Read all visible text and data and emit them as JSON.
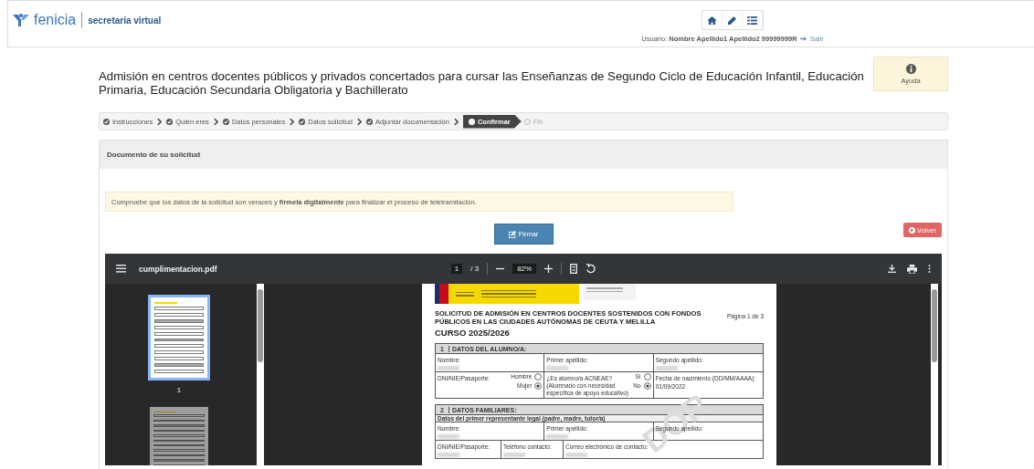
{
  "header": {
    "logo_text": "fenicia",
    "app_name": "secretaría virtual",
    "nav_buttons": [
      {
        "kind": "home"
      },
      {
        "kind": "edit"
      },
      {
        "kind": "list"
      }
    ],
    "user": "Usuario: **Nombre Apellido1 Apellido2 99999999R**",
    "logout": "Salir"
  },
  "title": "Admisión en centros docentes públicos y privados concertados para cursar las Enseñanzas de Segundo Ciclo de Educación Infantil, Educación Primaria, Educación Secundaria Obligatoria y Bachillerato",
  "help": {
    "label": "Ayuda"
  },
  "steps": [
    {
      "label": "Instrucciones",
      "completed": true,
      "selected": false
    },
    {
      "label": "Quién eres",
      "completed": true,
      "selected": false
    },
    {
      "label": "Datos personales",
      "completed": true,
      "selected": false
    },
    {
      "label": "Datos solicitud",
      "completed": true,
      "selected": false
    },
    {
      "label": "Adjuntar documentación",
      "completed": true,
      "selected": false
    },
    {
      "label": "Confirmar",
      "completed": false,
      "selected": true
    },
    {
      "label": "Fin",
      "completed": false,
      "selected": false
    }
  ],
  "panel": {
    "title": "Documento de su solicitud",
    "alert": "Compruebe que los datos de la solicitud son veraces y **fírmela digitalmente** para finalizar el proceso de teletramitación.",
    "sign_button": "Firmar",
    "back_button": "Volver"
  },
  "viewer": {
    "file_name": "cumplimentacion.pdf",
    "page": "1",
    "page_total": "/ 3",
    "zoom": "82%",
    "thumbnails": [
      {
        "label": "1",
        "selected": true
      },
      {
        "selected": false
      }
    ],
    "document": {
      "heading": "SOLICITUD DE ADMISIÓN EN CENTROS DOCENTES SOSTENIDOS CON FONDOS PÚBLICOS EN LAS CIUDADES AUTÓNOMAS DE CEUTA Y MELILLA",
      "page_label": "Página 1 de 3",
      "course": "CURSO 2025/2026",
      "stamp": "DOR",
      "sections": [
        {
          "number": "1",
          "title": "DATOS DEL ALUMNO/A:",
          "rows": [
            {
              "kind": "thirds",
              "cells": [
                {
                  "label": "Nombre:",
                  "redacted": true
                },
                {
                  "label": "Primer apellido:",
                  "redacted": true
                },
                {
                  "label": "Segundo apellido:",
                  "redacted": true
                }
              ]
            },
            {
              "kind": "thirds",
              "cells": [
                {
                  "label": "DNI/NIE/Pasaporte:",
                  "radios": [
                    {
                      "label": "Hombre",
                      "selected": false
                    },
                    {
                      "label": "Mujer",
                      "selected": true
                    }
                  ]
                },
                {
                  "label": "¿Es alumno/a ACNEAE?",
                  "note": "(Alumnado con necesidad específica de apoyo educativo)",
                  "radios": [
                    {
                      "label": "Sí",
                      "selected": false
                    },
                    {
                      "label": "No",
                      "selected": true
                    }
                  ]
                },
                {
                  "label": "Fecha de nacimiento (DD/MM/AAAA):",
                  "value": "01/09/2022"
                }
              ]
            }
          ]
        },
        {
          "number": "2",
          "title": "DATOS FAMILIARES:",
          "subtitle": "Datos del primer representante legal (padre, madre, tutor/a)",
          "rows": [
            {
              "kind": "thirds",
              "cells": [
                {
                  "label": "Nombre:",
                  "redacted": true
                },
                {
                  "label": "Primer apellido:",
                  "redacted": true
                },
                {
                  "label": "Segundo apellido:"
                }
              ]
            },
            {
              "kind": "split",
              "cells": [
                {
                  "label": "DNI/NIE/Pasaporte:",
                  "redacted": true
                },
                {
                  "label": "Teléfono contacto:",
                  "redacted": true
                },
                {
                  "label": "Correo electrónico de contacto:",
                  "redacted": true
                }
              ]
            }
          ]
        }
      ]
    }
  }
}
